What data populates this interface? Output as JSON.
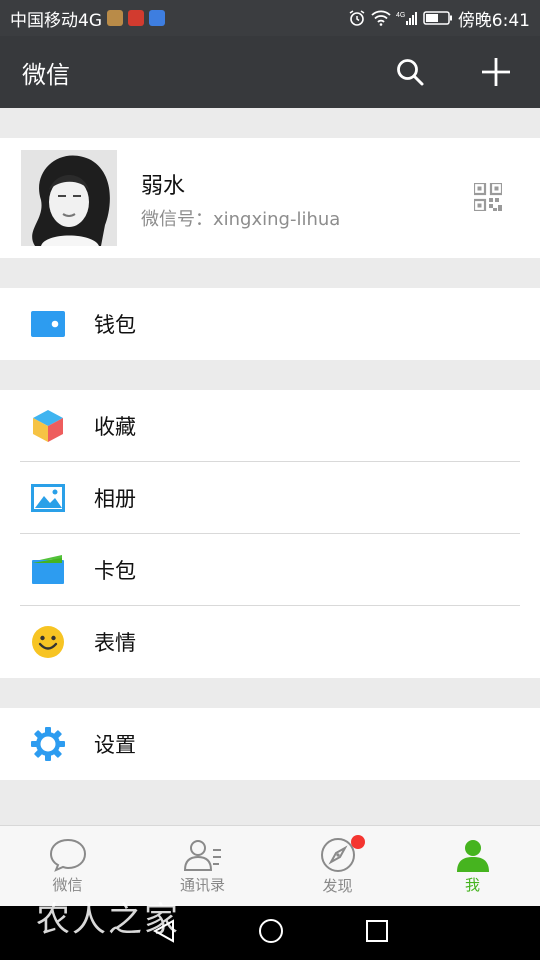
{
  "statusbar": {
    "carrier": "中国移动4G",
    "time": "傍晚6:41",
    "network": "4G"
  },
  "header": {
    "title": "微信"
  },
  "profile": {
    "name": "弱水",
    "wechat_id": "微信号：xingxing-lihua"
  },
  "wallet": {
    "label": "钱包"
  },
  "menu": [
    {
      "label": "收藏"
    },
    {
      "label": "相册"
    },
    {
      "label": "卡包"
    },
    {
      "label": "表情"
    }
  ],
  "settings": {
    "label": "设置"
  },
  "tabs": [
    {
      "label": "微信"
    },
    {
      "label": "通讯录"
    },
    {
      "label": "发现"
    },
    {
      "label": "我"
    }
  ],
  "watermark": "农人之家",
  "colors": {
    "accent_green": "#46b41f",
    "header_bg": "#37393c",
    "badge_red": "#f43530",
    "wallet_blue": "#2d9cf0"
  }
}
